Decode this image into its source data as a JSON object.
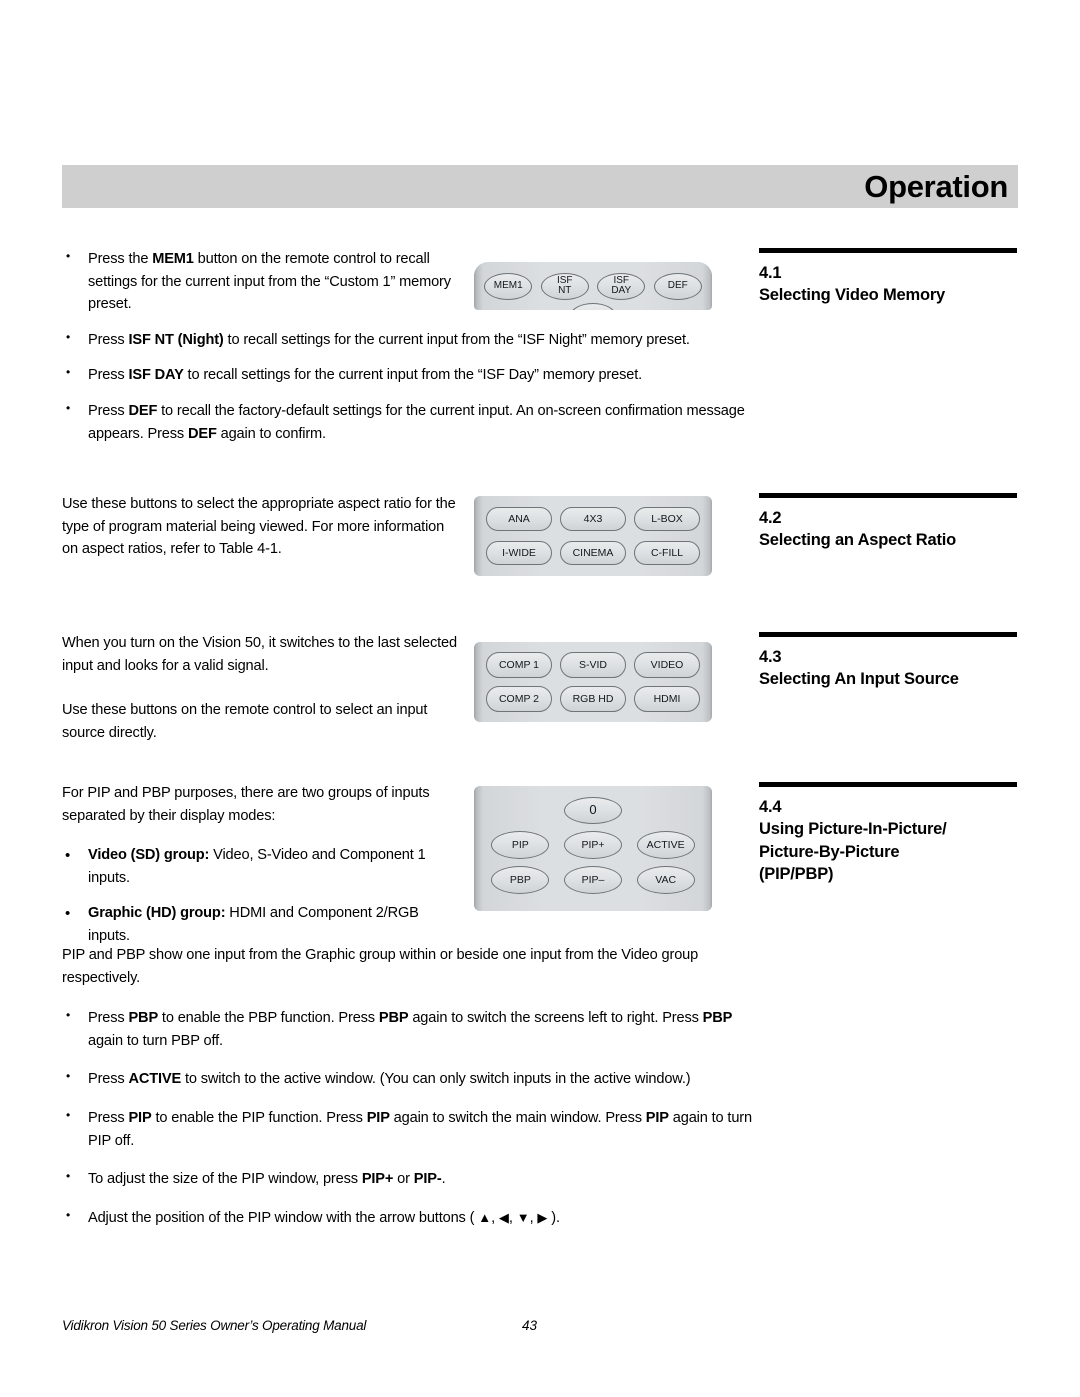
{
  "header": {
    "title": "Operation",
    "bar_color": "#cfcfcf"
  },
  "sections": [
    {
      "number": "4.1",
      "title": "Selecting Video Memory",
      "body_bullets": [
        "Press the MEM1 button on the remote control to recall settings for the current input from the “Custom 1” memory preset.",
        "Press ISF NT (Night) to recall settings for the current input from the “ISF Night” memory preset.",
        "Press ISF DAY to recall settings for the current input from the “ISF Day” memory preset.",
        "Press DEF to recall the factory-default settings for the current input. An on-screen confirmation message appears. Press DEF again to confirm."
      ],
      "remote": {
        "name": "video-memory-keys",
        "rows": [
          [
            "MEM1",
            "ISF\nNT",
            "ISF\nDAY",
            "DEF"
          ]
        ]
      }
    },
    {
      "number": "4.2",
      "title": "Selecting an Aspect Ratio",
      "paragraphs": [
        "Use these buttons to select the appropriate aspect ratio for the type of program material being viewed. For more information on aspect ratios, refer to Table 4-1."
      ],
      "remote": {
        "name": "aspect-ratio-keys",
        "rows": [
          [
            "ANA",
            "4X3",
            "L-BOX"
          ],
          [
            "I-WIDE",
            "CINEMA",
            "C-FILL"
          ]
        ]
      }
    },
    {
      "number": "4.3",
      "title": "Selecting An Input Source",
      "paragraphs": [
        "When you turn on the Vision 50, it switches to the last selected input and looks for a valid signal.",
        "Use these buttons on the remote control to select an input source directly."
      ],
      "remote": {
        "name": "input-source-keys",
        "rows": [
          [
            "COMP 1",
            "S-VID",
            "VIDEO"
          ],
          [
            "COMP 2",
            "RGB HD",
            "HDMI"
          ]
        ]
      }
    },
    {
      "number": "4.4",
      "title_lines": [
        "Using Picture-In-Picture/",
        "Picture-By-Picture",
        "(PIP/PBP)"
      ],
      "paragraphs": [
        "For PIP and PBP purposes, there are two groups of inputs separated by their display modes:"
      ],
      "group_bullets": [
        {
          "label": "Video (SD) group:",
          "text": " Video, S-Video and Component 1 inputs."
        },
        {
          "label": "Graphic (HD) group:",
          "text": "  HDMI and Component 2/RGB inputs."
        }
      ],
      "remote": {
        "name": "pip-pbp-keys",
        "rows": [
          [
            "0"
          ],
          [
            "PIP",
            "PIP+",
            "ACTIVE"
          ],
          [
            "PBP",
            "PIP–",
            "VAC"
          ]
        ]
      }
    }
  ],
  "lower": {
    "intro": "PIP and PBP show one input from the Graphic group within or beside one input from the Video group respectively.",
    "bullets": [
      "Press PBP to enable the PBP function. Press PBP again to switch the screens left to right. Press PBP again to turn PBP off.",
      "Press ACTIVE to switch to the active window. (You can only switch inputs in the active window.)",
      "Press PIP to enable the PIP function. Press PIP again to switch the main window. Press PIP again to turn PIP off.",
      "To adjust the size of the PIP window, press PIP+ or PIP-.",
      "Adjust the position of the PIP window with the arrow buttons ( ▲, ◀, ▼, ▶ )."
    ]
  },
  "footer": {
    "text": "Vidikron Vision 50 Series Owner’s Operating Manual",
    "page": "43"
  }
}
